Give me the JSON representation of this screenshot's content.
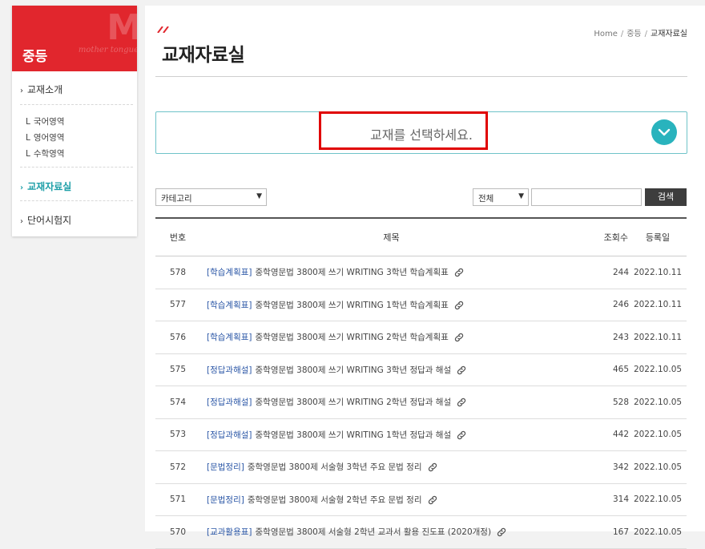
{
  "sidebar": {
    "title": "중등",
    "watermark": "M",
    "watermark_sub": "mother tongue",
    "items": [
      {
        "label": "교재소개"
      },
      {
        "label": "교재자료실"
      },
      {
        "label": "단어시험지"
      }
    ],
    "subitems": [
      {
        "label": "국어영역"
      },
      {
        "label": "영어영역"
      },
      {
        "label": "수학영역"
      }
    ]
  },
  "header": {
    "title": "교재자료실",
    "breadcrumb": [
      "Home",
      "중등",
      "교재자료실"
    ]
  },
  "selector": {
    "text": "교재를 선택하세요."
  },
  "filters": {
    "category": "카테고리",
    "scope": "전체",
    "search_value": "",
    "search_button": "검색"
  },
  "table": {
    "headers": {
      "no": "번호",
      "subject": "제목",
      "views": "조회수",
      "date": "등록일"
    },
    "rows": [
      {
        "no": "578",
        "cat": "[학습계획표]",
        "title": "중학영문법 3800제 쓰기 WRITING 3학년 학습계획표",
        "views": "244",
        "date": "2022.10.11"
      },
      {
        "no": "577",
        "cat": "[학습계획표]",
        "title": "중학영문법 3800제 쓰기 WRITING 1학년 학습계획표",
        "views": "246",
        "date": "2022.10.11"
      },
      {
        "no": "576",
        "cat": "[학습계획표]",
        "title": "중학영문법 3800제 쓰기 WRITING 2학년 학습계획표",
        "views": "243",
        "date": "2022.10.11"
      },
      {
        "no": "575",
        "cat": "[정답과해설]",
        "title": "중학영문법 3800제 쓰기 WRITING 3학년 정답과 해설",
        "views": "465",
        "date": "2022.10.05"
      },
      {
        "no": "574",
        "cat": "[정답과해설]",
        "title": "중학영문법 3800제 쓰기 WRITING 2학년 정답과 해설",
        "views": "528",
        "date": "2022.10.05"
      },
      {
        "no": "573",
        "cat": "[정답과해설]",
        "title": "중학영문법 3800제 쓰기 WRITING 1학년 정답과 해설",
        "views": "442",
        "date": "2022.10.05"
      },
      {
        "no": "572",
        "cat": "[문법정리]",
        "title": "중학영문법 3800제 서술형 3학년 주요 문법 정리",
        "views": "342",
        "date": "2022.10.05"
      },
      {
        "no": "571",
        "cat": "[문법정리]",
        "title": "중학영문법 3800제 서술형 2학년 주요 문법 정리",
        "views": "314",
        "date": "2022.10.05"
      },
      {
        "no": "570",
        "cat": "[교과활용표]",
        "title": "중학영문법 3800제 서술형 2학년 교과서 활용 진도표 (2020개정)",
        "views": "167",
        "date": "2022.10.05"
      }
    ]
  },
  "colors": {
    "brand_red": "#e1262d",
    "accent_teal": "#29b3bd",
    "category_blue": "#2a56a6",
    "highlight_red": "#e00000"
  },
  "icons": {
    "link": "link-icon",
    "dropdown": "chevron-down-icon",
    "side": "chevron-right-icon"
  }
}
